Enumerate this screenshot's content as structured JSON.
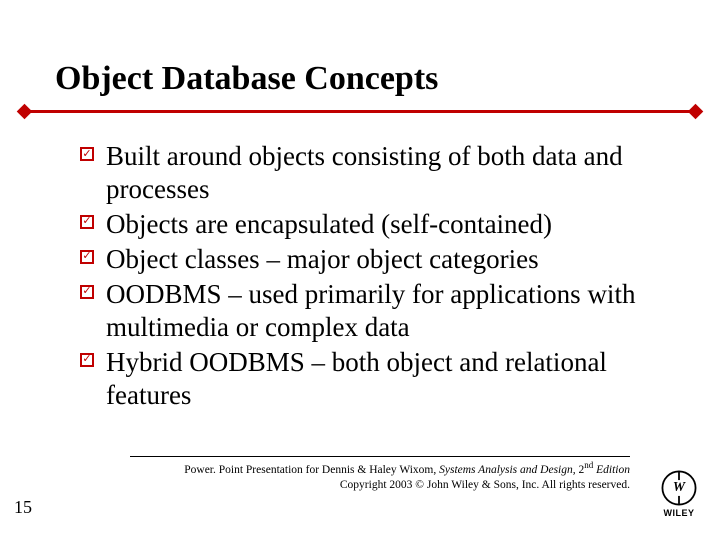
{
  "title": "Object Database Concepts",
  "bullets": [
    "Built around objects consisting of both data and processes",
    "Objects are encapsulated (self-contained)",
    "Object classes – major object categories",
    "OODBMS – used primarily for applications with multimedia or complex data",
    "Hybrid OODBMS – both object and relational features"
  ],
  "footer": {
    "line1_prefix": "Power. Point Presentation for Dennis & Haley Wixom, ",
    "book": "Systems Analysis and Design, ",
    "edition_num": "2",
    "edition_suffix": "nd",
    "edition_tail": " Edition",
    "line2": "Copyright 2003 © John Wiley & Sons, Inc.  All rights reserved."
  },
  "slide_number": "15",
  "logo_text": "WILEY"
}
